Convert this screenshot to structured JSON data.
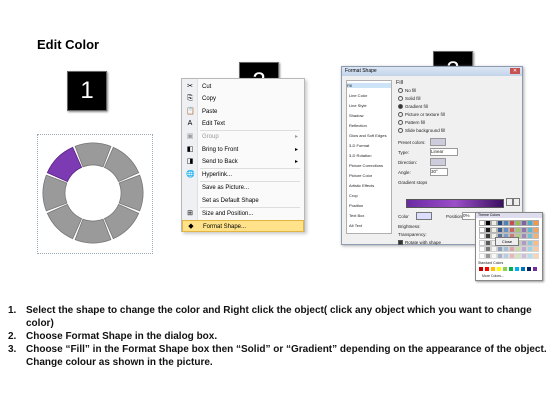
{
  "heading": "Edit Color",
  "badges": [
    "1",
    "2",
    "3"
  ],
  "context_menu": {
    "items": [
      {
        "label": "Cut",
        "icon": "scissors-icon",
        "glyph": "✂",
        "state": "normal"
      },
      {
        "label": "Copy",
        "icon": "copy-icon",
        "glyph": "⎘",
        "state": "normal"
      },
      {
        "label": "Paste",
        "icon": "paste-icon",
        "glyph": "📋",
        "state": "normal"
      },
      {
        "label": "Edit Text",
        "icon": "edit-text-icon",
        "glyph": "A",
        "state": "normal"
      },
      {
        "label": "Group",
        "icon": "group-icon",
        "glyph": "▣",
        "state": "disabled",
        "submenu": true
      },
      {
        "label": "Bring to Front",
        "icon": "bring-front-icon",
        "glyph": "◧",
        "state": "normal",
        "submenu": true
      },
      {
        "label": "Send to Back",
        "icon": "send-back-icon",
        "glyph": "◨",
        "state": "normal",
        "submenu": true
      },
      {
        "label": "Hyperlink...",
        "icon": "hyperlink-icon",
        "glyph": "🌐",
        "state": "normal"
      },
      {
        "label": "Save as Picture...",
        "icon": "",
        "glyph": "",
        "state": "normal"
      },
      {
        "label": "Set as Default Shape",
        "icon": "",
        "glyph": "",
        "state": "normal"
      },
      {
        "label": "Size and Position...",
        "icon": "size-position-icon",
        "glyph": "⊞",
        "state": "normal"
      },
      {
        "label": "Format Shape...",
        "icon": "format-shape-icon",
        "glyph": "◆",
        "state": "highlighted"
      }
    ]
  },
  "format_dialog": {
    "title": "Format Shape",
    "categories": [
      "Fill",
      "Line Color",
      "Line Style",
      "Shadow",
      "Reflection",
      "Glow and Soft Edges",
      "3-D Format",
      "3-D Rotation",
      "Picture Corrections",
      "Picture Color",
      "Artistic Effects",
      "Crop",
      "Position",
      "Text Box",
      "Alt Text"
    ],
    "section": "Fill",
    "options": [
      "No fill",
      "Solid fill",
      "Gradient fill",
      "Picture or texture fill",
      "Pattern fill",
      "Slide background fill"
    ],
    "selected_option": "Gradient fill",
    "preset_label": "Preset colors:",
    "type_label": "Type:",
    "type_value": "Linear",
    "direction_label": "Direction:",
    "angle_label": "Angle:",
    "angle_value": "30°",
    "stops_label": "Gradient stops",
    "color_label": "Color",
    "position_label": "Position:",
    "position_value": "0%",
    "brightness_label": "Brightness:",
    "transparency_label": "Transparency:",
    "rotate_label": "Rotate with shape",
    "close_label": "Close",
    "palette_header": "Theme Colors",
    "standard_label": "Standard Colors",
    "more_label": "More Colors..."
  },
  "colors": {
    "ring_gray": "#9a9a9a",
    "ring_highlight": "#7d3bb3",
    "menu_highlight": "#ffe28a"
  },
  "steps": [
    {
      "n": "1.",
      "text": "Select the shape to change the color and Right click the object( click any object which you want to change color)"
    },
    {
      "n": "2.",
      "text": "Choose Format Shape in the dialog box."
    },
    {
      "n": "3.",
      "text": "Choose “Fill” in the Format Shape box then “Solid” or “Gradient” depending on the appearance of the object. Change colour as shown in the picture."
    }
  ]
}
